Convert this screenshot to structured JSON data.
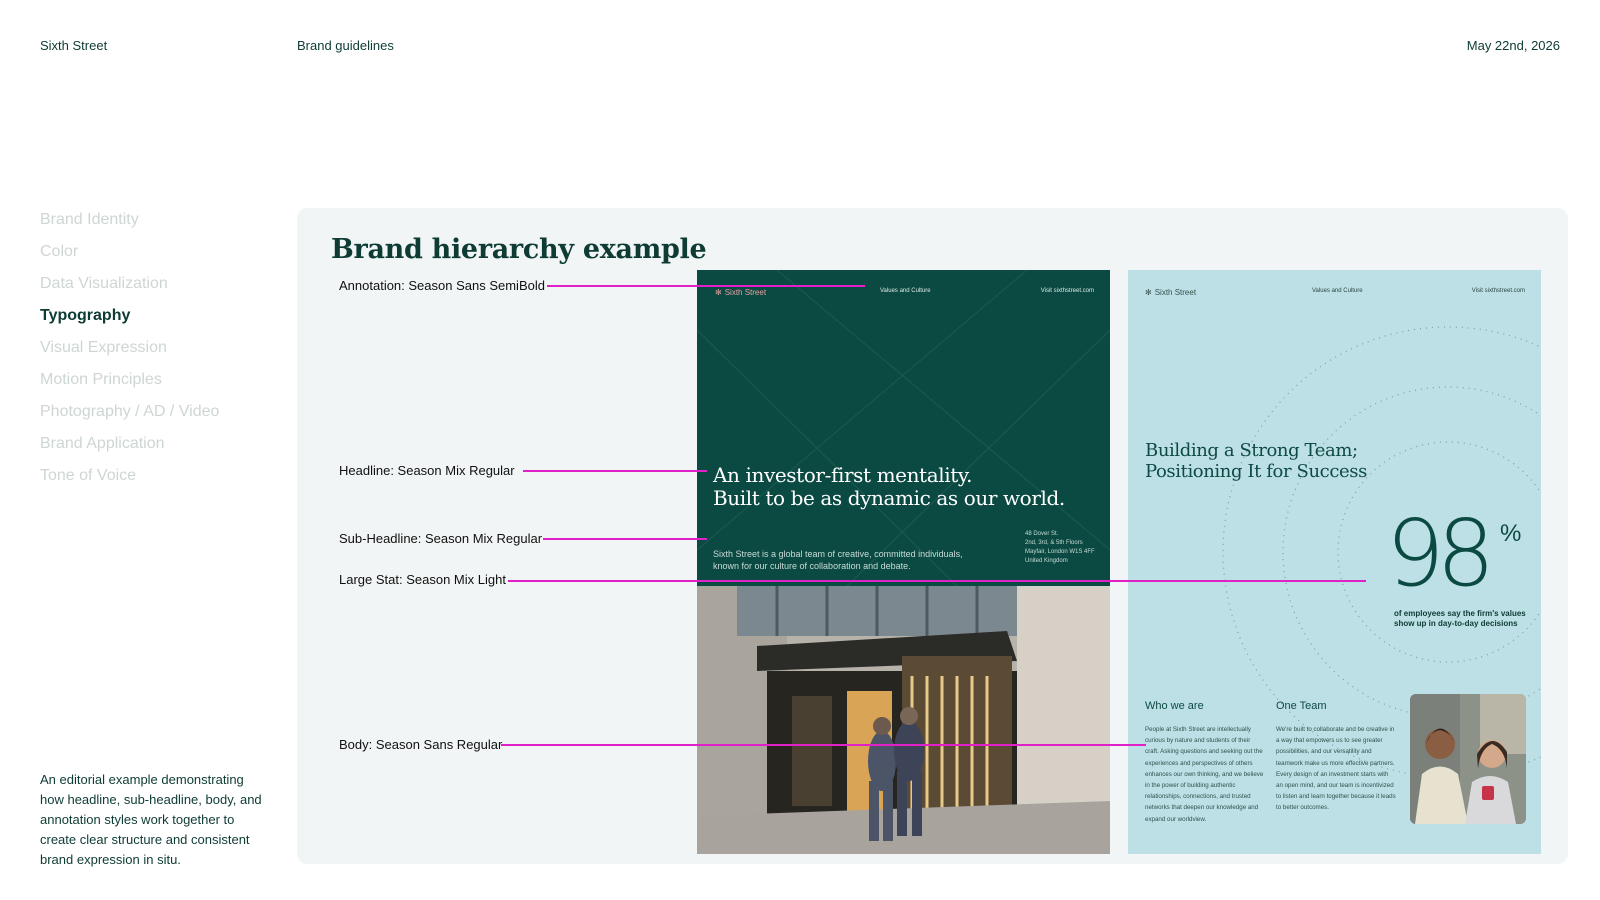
{
  "header": {
    "brand": "Sixth Street",
    "title": "Brand guidelines",
    "date": "May 22nd, 2026"
  },
  "sidebar": {
    "items": [
      {
        "label": "Brand Identity",
        "active": false
      },
      {
        "label": "Color",
        "active": false
      },
      {
        "label": "Data Visualization",
        "active": false
      },
      {
        "label": "Typography",
        "active": true
      },
      {
        "label": "Visual Expression",
        "active": false
      },
      {
        "label": "Motion Principles",
        "active": false
      },
      {
        "label": "Photography / AD / Video",
        "active": false
      },
      {
        "label": "Brand Application",
        "active": false
      },
      {
        "label": "Tone of Voice",
        "active": false
      }
    ],
    "description": "An editorial example demonstrating how headline, sub-headline, body, and annotation styles work together to create clear structure and consistent brand expression in situ."
  },
  "panel": {
    "title": "Brand hierarchy example",
    "annotations": [
      {
        "label": "Annotation: Season Sans SemiBold"
      },
      {
        "label": "Headline: Season Mix Regular"
      },
      {
        "label": "Sub-Headline: Season Mix Regular"
      },
      {
        "label": "Large Stat: Season Mix Light"
      },
      {
        "label": "Body: Season Sans Regular"
      }
    ],
    "annotation_color": "#e021c8"
  },
  "poster_green": {
    "logo": "Sixth Street",
    "nav": "Values and Culture",
    "visit": "Visit sixthstreet.com",
    "headline": "An investor-first mentality.\nBuilt to be as dynamic as our world.",
    "subheadline": "Sixth Street is a global team of creative, committed individuals,\nknown for our culture of collaboration and debate.",
    "address": "48 Dover St.\n2nd, 3rd, & 5th Floors\nMayfair, London W1S 4FF\nUnited Kingdom",
    "background": "#0b4a42"
  },
  "poster_blue": {
    "logo": "Sixth Street",
    "nav": "Values and Culture",
    "visit": "Visit sixthstreet.com",
    "headline": "Building a Strong Team;\nPositioning It for Success",
    "stat_value": "98",
    "stat_unit": "%",
    "stat_caption": "of employees say the firm's values show up in day-to-day decisions",
    "col1_title": "Who we are",
    "col1_body": "People at Sixth Street are intellectually curious by nature and students of their craft. Asking questions and seeking out the experiences and perspectives of others enhances our own thinking, and we believe in the power of building authentic relationships, connections, and trusted networks that deepen our knowledge and expand our worldview.",
    "col2_title": "One Team",
    "col2_body": "We're built to collaborate and be creative in a way that empowers us to see greater possibilities, and our versatility and teamwork make us more effective partners. Every design of an investment starts with an open mind, and our team is incentivized to listen and learn together because it leads to better outcomes.",
    "background": "#bde0e6"
  }
}
